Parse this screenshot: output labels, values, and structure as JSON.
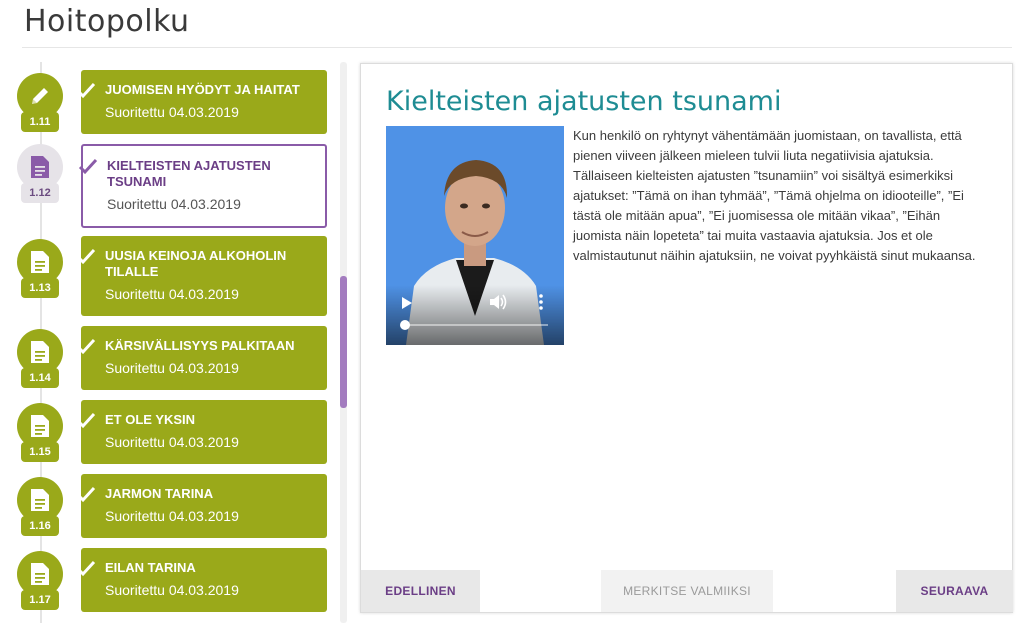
{
  "header": {
    "title": "Hoitopolku"
  },
  "timeline": {
    "steps": [
      {
        "number": "1.11",
        "title": "JUOMISEN HYÖDYT JA HAITAT",
        "status": "Suoritettu 04.03.2019",
        "icon": "pencil-icon",
        "current": false
      },
      {
        "number": "1.12",
        "title": "KIELTEISTEN AJATUSTEN TSUNAMI",
        "status": "Suoritettu 04.03.2019",
        "icon": "document-icon",
        "current": true
      },
      {
        "number": "1.13",
        "title": "UUSIA KEINOJA ALKOHOLIN TILALLE",
        "status": "Suoritettu 04.03.2019",
        "icon": "document-icon",
        "current": false
      },
      {
        "number": "1.14",
        "title": "KÄRSIVÄLLISYYS PALKITAAN",
        "status": "Suoritettu 04.03.2019",
        "icon": "document-icon",
        "current": false
      },
      {
        "number": "1.15",
        "title": "ET OLE YKSIN",
        "status": "Suoritettu 04.03.2019",
        "icon": "document-icon",
        "current": false
      },
      {
        "number": "1.16",
        "title": "JARMON TARINA",
        "status": "Suoritettu 04.03.2019",
        "icon": "document-icon",
        "current": false
      },
      {
        "number": "1.17",
        "title": "EILAN TARINA",
        "status": "Suoritettu 04.03.2019",
        "icon": "document-icon",
        "current": false
      }
    ]
  },
  "content": {
    "title": "Kielteisten ajatusten tsunami",
    "body": "Kun henkilö on ryhtynyt vähentämään juomistaan, on tavallista, että pienen viiveen jälkeen mieleen tulvii liuta negatiivisia ajatuksia. Tällaiseen kielteisten ajatusten ”tsunamiin” voi sisältyä esimerkiksi ajatukset: ”Tämä on ihan tyhmää”, ”Tämä ohjelma on idiooteille”, ”Ei tästä ole mitään apua”, ”Ei juomisessa ole mitään vikaa”, ”Eihän juomista näin lopeteta” tai muita vastaavia ajatuksia. Jos et ole valmistautunut näihin ajatuksiin, ne voivat pyyhkäistä sinut mukaansa."
  },
  "footer": {
    "prev_label": "EDELLINEN",
    "mark_label": "MERKITSE VALMIIKSI",
    "next_label": "SEURAAVA"
  },
  "colors": {
    "accent_green": "#9aa91a",
    "accent_purple": "#6b3e86",
    "title_teal": "#1e8c93"
  }
}
